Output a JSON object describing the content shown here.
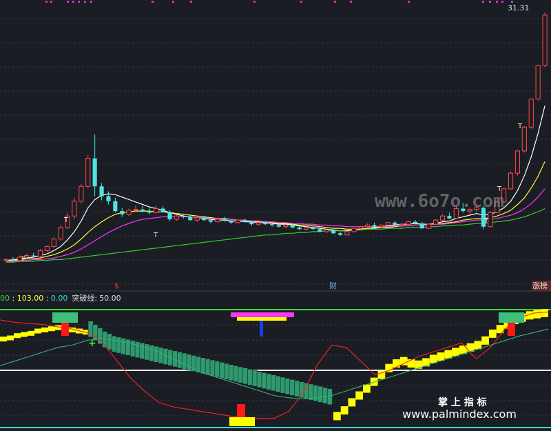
{
  "colors": {
    "background": "#1b1d24",
    "grid": "#3a3f55",
    "candle_up": "#ff4b4b",
    "candle_down": "#4fe3e3",
    "ma_white": "#ffffff",
    "ma_yellow": "#ffff33",
    "ma_magenta": "#ff33ff",
    "ma_green": "#33cc33",
    "line_red": "#ff2020",
    "line_teal": "#3ab07a",
    "step_yellow": "#ffff00",
    "step_green": "#2e9a6e",
    "white_level": "#ffffff",
    "green_level": "#33dd33",
    "cyan_level": "#33dddd"
  },
  "labels": {
    "price_max": "31.31",
    "marker_s": "$",
    "marker_cai": "财",
    "marker_zhangbang": "涨榜",
    "indicator_v1": "00",
    "sep1": " : ",
    "indicator_v2": "103.00",
    "sep2": " : ",
    "indicator_v3": "0.00",
    "indicator_name": "突破线:",
    "indicator_val": "50.00",
    "watermark_url1": "www.6o7o.com",
    "watermark_cn": "掌 上 指 标",
    "watermark_url2": "www.palmindex.com"
  },
  "chart_data": [
    {
      "type": "candlestick",
      "panel": "price",
      "max_label": "31.31",
      "ylim": [
        0,
        32
      ],
      "candles": [
        [
          1.2,
          1.5,
          1.0,
          1.3
        ],
        [
          1.3,
          1.6,
          1.1,
          1.2
        ],
        [
          1.2,
          1.8,
          1.0,
          1.6
        ],
        [
          1.6,
          2.0,
          1.4,
          1.8
        ],
        [
          1.8,
          2.1,
          1.5,
          1.7
        ],
        [
          1.7,
          2.6,
          1.6,
          2.4
        ],
        [
          2.4,
          3.0,
          2.2,
          2.9
        ],
        [
          2.9,
          4.0,
          2.7,
          3.8
        ],
        [
          3.8,
          5.5,
          3.6,
          5.2
        ],
        [
          5.2,
          7.0,
          5.0,
          6.6
        ],
        [
          6.6,
          8.8,
          6.2,
          8.4
        ],
        [
          8.4,
          10.5,
          8.1,
          10.2
        ],
        [
          10.2,
          14.0,
          10.0,
          13.6
        ],
        [
          13.6,
          16.5,
          9.0,
          10.2
        ],
        [
          10.2,
          10.6,
          8.5,
          9.0
        ],
        [
          9.0,
          9.6,
          8.0,
          8.4
        ],
        [
          8.4,
          8.8,
          7.0,
          7.2
        ],
        [
          7.2,
          7.6,
          6.5,
          6.8
        ],
        [
          6.8,
          7.5,
          6.6,
          7.3
        ],
        [
          7.3,
          7.9,
          7.0,
          7.4
        ],
        [
          7.4,
          7.8,
          7.0,
          7.2
        ],
        [
          7.2,
          7.6,
          6.8,
          7.0
        ],
        [
          7.0,
          7.8,
          6.9,
          7.5
        ],
        [
          7.5,
          7.8,
          7.0,
          7.1
        ],
        [
          7.1,
          7.3,
          6.0,
          6.2
        ],
        [
          6.2,
          6.8,
          6.0,
          6.6
        ],
        [
          6.6,
          6.9,
          6.3,
          6.5
        ],
        [
          6.5,
          6.7,
          6.0,
          6.1
        ],
        [
          6.1,
          6.5,
          5.9,
          6.4
        ],
        [
          6.4,
          6.6,
          6.0,
          6.1
        ],
        [
          6.1,
          6.3,
          5.7,
          5.9
        ],
        [
          5.9,
          6.4,
          5.8,
          6.2
        ],
        [
          6.2,
          6.5,
          5.9,
          6.0
        ],
        [
          6.0,
          6.2,
          5.6,
          5.8
        ],
        [
          5.8,
          6.2,
          5.7,
          6.1
        ],
        [
          6.1,
          6.3,
          5.8,
          5.9
        ],
        [
          5.9,
          6.0,
          5.4,
          5.6
        ],
        [
          5.6,
          5.9,
          5.4,
          5.8
        ],
        [
          5.8,
          6.0,
          5.5,
          5.6
        ],
        [
          5.6,
          5.8,
          5.3,
          5.5
        ],
        [
          5.5,
          5.7,
          5.2,
          5.3
        ],
        [
          5.3,
          5.6,
          5.1,
          5.5
        ],
        [
          5.5,
          5.7,
          5.1,
          5.2
        ],
        [
          5.2,
          5.4,
          4.9,
          5.0
        ],
        [
          5.0,
          5.3,
          4.8,
          5.2
        ],
        [
          5.2,
          5.4,
          4.9,
          5.0
        ],
        [
          5.0,
          5.1,
          4.6,
          4.7
        ],
        [
          4.7,
          5.0,
          4.5,
          4.9
        ],
        [
          4.9,
          5.0,
          4.4,
          4.5
        ],
        [
          4.5,
          4.7,
          4.2,
          4.3
        ],
        [
          4.3,
          4.8,
          4.2,
          4.7
        ],
        [
          4.7,
          5.2,
          4.6,
          5.1
        ],
        [
          5.1,
          5.4,
          4.9,
          5.3
        ],
        [
          5.3,
          5.7,
          5.1,
          5.5
        ],
        [
          5.5,
          5.8,
          5.2,
          5.3
        ],
        [
          5.3,
          5.6,
          5.1,
          5.5
        ],
        [
          5.5,
          5.9,
          5.4,
          5.8
        ],
        [
          5.8,
          6.0,
          5.4,
          5.5
        ],
        [
          5.5,
          5.7,
          5.2,
          5.6
        ],
        [
          5.6,
          6.0,
          5.5,
          5.9
        ],
        [
          5.9,
          6.1,
          5.6,
          5.7
        ],
        [
          5.7,
          5.9,
          5.0,
          5.1
        ],
        [
          5.1,
          5.7,
          5.0,
          5.6
        ],
        [
          5.6,
          6.2,
          5.5,
          6.1
        ],
        [
          6.1,
          6.8,
          6.0,
          6.6
        ],
        [
          6.6,
          7.0,
          6.2,
          6.3
        ],
        [
          6.3,
          7.8,
          6.2,
          7.5
        ],
        [
          7.5,
          8.2,
          7.0,
          7.2
        ],
        [
          7.2,
          7.6,
          6.7,
          7.4
        ],
        [
          7.4,
          7.8,
          7.1,
          7.6
        ],
        [
          7.6,
          7.8,
          5.0,
          5.3
        ],
        [
          5.3,
          7.2,
          5.2,
          7.0
        ],
        [
          7.0,
          8.5,
          6.9,
          8.3
        ],
        [
          8.3,
          10.0,
          8.2,
          9.9
        ],
        [
          9.9,
          12.0,
          9.8,
          11.8
        ],
        [
          11.8,
          14.6,
          11.5,
          14.5
        ],
        [
          14.5,
          17.5,
          14.3,
          17.4
        ],
        [
          17.4,
          20.9,
          17.2,
          20.8
        ],
        [
          20.8,
          25.0,
          20.6,
          24.9
        ],
        [
          24.9,
          31.31,
          24.7,
          31.0
        ]
      ],
      "ma_series": [
        {
          "color": "white",
          "values": [
            1.2,
            1.3,
            1.4,
            1.5,
            1.6,
            1.8,
            2.0,
            2.4,
            2.9,
            3.7,
            4.7,
            6.0,
            7.6,
            8.6,
            9.1,
            9.3,
            9.2,
            8.9,
            8.6,
            8.3,
            8.0,
            7.7,
            7.5,
            7.3,
            7.0,
            6.8,
            6.6,
            6.5,
            6.4,
            6.3,
            6.2,
            6.1,
            6.1,
            6.0,
            6.0,
            5.9,
            5.9,
            5.8,
            5.8,
            5.7,
            5.6,
            5.6,
            5.5,
            5.4,
            5.3,
            5.2,
            5.1,
            5.0,
            4.9,
            4.8,
            4.8,
            4.9,
            5.0,
            5.1,
            5.2,
            5.3,
            5.4,
            5.5,
            5.6,
            5.6,
            5.7,
            5.6,
            5.6,
            5.7,
            5.9,
            6.0,
            6.3,
            6.5,
            6.7,
            6.9,
            6.7,
            6.8,
            7.1,
            7.6,
            8.4,
            9.7,
            11.5,
            13.8,
            16.6,
            20.0
          ]
        },
        {
          "color": "yellow",
          "values": [
            1.2,
            1.2,
            1.3,
            1.4,
            1.4,
            1.5,
            1.7,
            1.9,
            2.2,
            2.6,
            3.1,
            3.8,
            4.6,
            5.3,
            5.9,
            6.4,
            6.8,
            7.0,
            7.1,
            7.2,
            7.2,
            7.2,
            7.1,
            7.1,
            7.0,
            6.9,
            6.8,
            6.7,
            6.6,
            6.5,
            6.4,
            6.3,
            6.3,
            6.2,
            6.1,
            6.1,
            6.0,
            5.9,
            5.9,
            5.8,
            5.7,
            5.7,
            5.6,
            5.5,
            5.5,
            5.4,
            5.3,
            5.2,
            5.1,
            5.1,
            5.0,
            5.0,
            5.0,
            5.1,
            5.1,
            5.2,
            5.2,
            5.3,
            5.4,
            5.4,
            5.5,
            5.5,
            5.5,
            5.6,
            5.7,
            5.8,
            5.9,
            6.1,
            6.2,
            6.3,
            6.3,
            6.4,
            6.6,
            6.9,
            7.3,
            8.0,
            8.8,
            10.0,
            11.4,
            13.2
          ]
        },
        {
          "color": "magenta",
          "values": [
            1.1,
            1.1,
            1.2,
            1.2,
            1.3,
            1.3,
            1.4,
            1.5,
            1.7,
            1.9,
            2.2,
            2.6,
            3.1,
            3.6,
            4.1,
            4.6,
            5.0,
            5.4,
            5.7,
            6.0,
            6.2,
            6.3,
            6.4,
            6.5,
            6.5,
            6.5,
            6.5,
            6.5,
            6.4,
            6.4,
            6.3,
            6.3,
            6.2,
            6.2,
            6.1,
            6.1,
            6.0,
            6.0,
            5.9,
            5.9,
            5.8,
            5.8,
            5.7,
            5.7,
            5.6,
            5.6,
            5.5,
            5.5,
            5.4,
            5.4,
            5.3,
            5.3,
            5.3,
            5.3,
            5.3,
            5.3,
            5.3,
            5.4,
            5.4,
            5.4,
            5.5,
            5.5,
            5.5,
            5.6,
            5.6,
            5.7,
            5.8,
            5.9,
            6.0,
            6.1,
            6.1,
            6.2,
            6.3,
            6.5,
            6.7,
            7.0,
            7.5,
            8.1,
            8.9,
            9.9
          ]
        },
        {
          "color": "green",
          "values": [
            1.0,
            1.0,
            1.1,
            1.1,
            1.1,
            1.2,
            1.2,
            1.3,
            1.3,
            1.4,
            1.5,
            1.6,
            1.7,
            1.8,
            1.9,
            2.0,
            2.1,
            2.2,
            2.3,
            2.4,
            2.5,
            2.6,
            2.7,
            2.8,
            2.9,
            3.0,
            3.1,
            3.2,
            3.3,
            3.4,
            3.5,
            3.6,
            3.7,
            3.8,
            3.9,
            4.0,
            4.1,
            4.2,
            4.3,
            4.3,
            4.4,
            4.5,
            4.5,
            4.6,
            4.6,
            4.7,
            4.7,
            4.8,
            4.8,
            4.8,
            4.9,
            4.9,
            4.9,
            5.0,
            5.0,
            5.0,
            5.1,
            5.1,
            5.1,
            5.2,
            5.2,
            5.2,
            5.3,
            5.3,
            5.4,
            5.4,
            5.5,
            5.5,
            5.6,
            5.7,
            5.7,
            5.8,
            5.9,
            6.0,
            6.1,
            6.3,
            6.5,
            6.8,
            7.1,
            7.5
          ]
        }
      ]
    },
    {
      "type": "indicator",
      "panel": "lower",
      "ylim": [
        0,
        103
      ],
      "levels": {
        "top": 103,
        "breakout": 50,
        "bottom": 0
      },
      "step_series": [
        {
          "name": "yellow-steps",
          "values": [
            77,
            78,
            80,
            81,
            82,
            84,
            85,
            86,
            87,
            86,
            85,
            84,
            83,
            82
          ]
        },
        {
          "name": "green-steps",
          "values": [
            81,
            78,
            75,
            72,
            70,
            68,
            67,
            66,
            65,
            64,
            63,
            62,
            61,
            60,
            59,
            58,
            57,
            56,
            55,
            54,
            53,
            52,
            51,
            50,
            49,
            48,
            47,
            46,
            45,
            44,
            43,
            42,
            41,
            40,
            39,
            38,
            37,
            36,
            35,
            34,
            33,
            32,
            31,
            30,
            29,
            28,
            27,
            26,
            25,
            24,
            23,
            22
          ]
        },
        {
          "name": "yellow-rising",
          "values": [
            10,
            15,
            22,
            28,
            34,
            40,
            46,
            52,
            56,
            58,
            56,
            55,
            57,
            60,
            62,
            64,
            66,
            68,
            70,
            72,
            76,
            82,
            86,
            90,
            94,
            96,
            98,
            99,
            100
          ]
        }
      ],
      "line_series": [
        {
          "name": "red",
          "values": [
            94,
            92,
            91,
            90,
            88,
            86,
            83,
            76,
            60,
            44,
            32,
            22,
            18,
            16,
            14,
            12,
            10,
            9,
            8,
            8,
            14,
            30,
            55,
            72,
            70,
            58,
            46,
            50,
            56,
            62,
            66,
            70,
            74,
            60,
            70,
            86,
            96,
            100,
            101
          ]
        },
        {
          "name": "teal",
          "values": [
            54,
            58,
            62,
            66,
            70,
            72,
            76,
            78,
            76,
            74,
            70,
            66,
            60,
            54,
            48,
            44,
            40,
            36,
            32,
            28,
            26,
            25,
            26,
            28,
            32,
            36,
            40,
            44,
            48,
            52,
            56,
            60,
            64,
            68,
            72,
            76,
            80,
            83,
            86
          ]
        }
      ],
      "markers": [
        "top-left green block",
        "top-right green block",
        "magenta/yellow bar near top center",
        "red block near bottom"
      ]
    }
  ]
}
